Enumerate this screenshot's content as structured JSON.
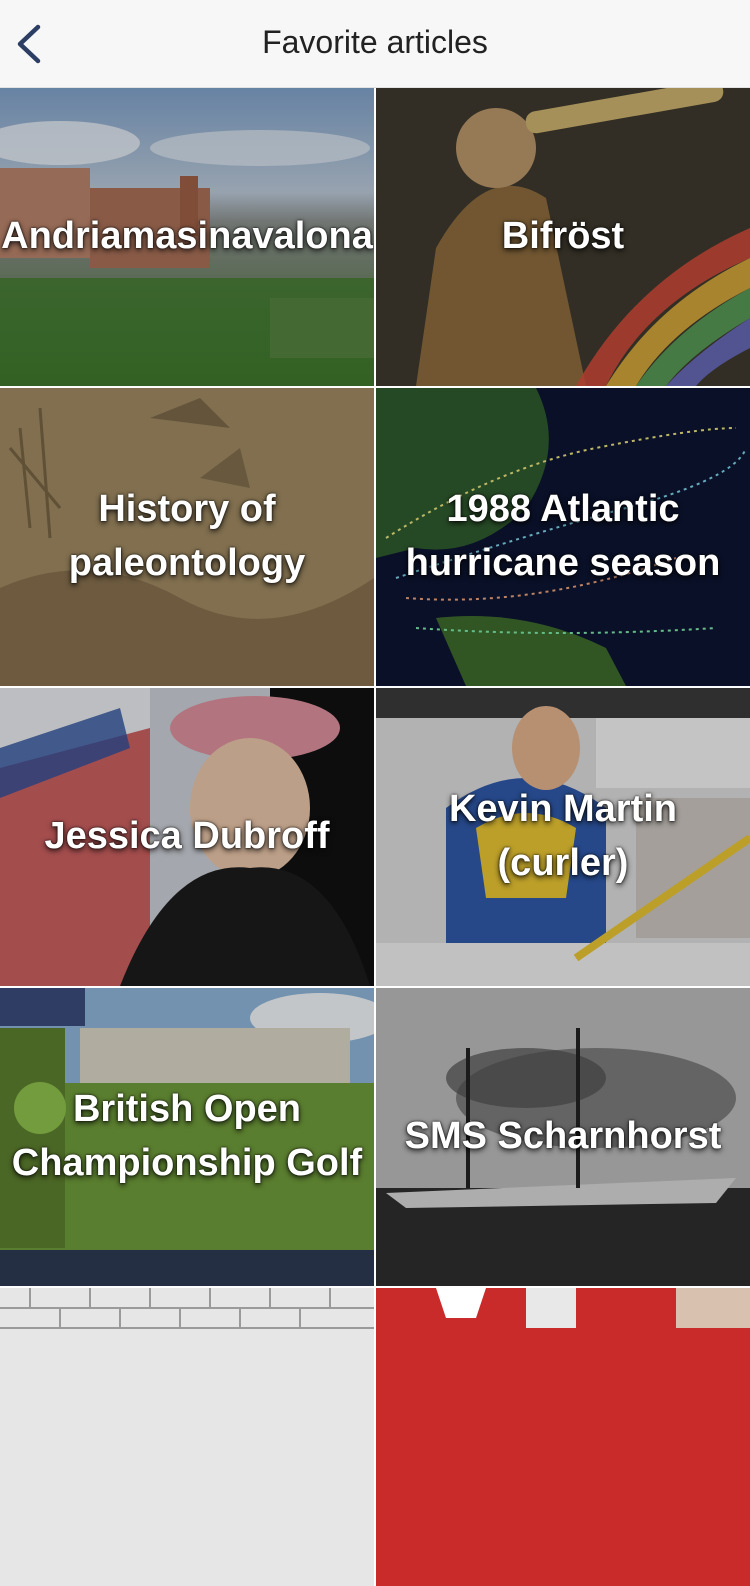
{
  "header": {
    "title": "Favorite articles",
    "back_icon": "chevron-left-icon"
  },
  "articles": [
    {
      "title": "Andriamasinavalona"
    },
    {
      "title": "Bifröst"
    },
    {
      "title": "History of paleontology"
    },
    {
      "title": "1988 Atlantic hurricane season"
    },
    {
      "title": "Jessica Dubroff"
    },
    {
      "title": "Kevin Martin (curler)"
    },
    {
      "title": "British Open Championship Golf"
    },
    {
      "title": "SMS Scharnhorst"
    },
    {
      "title": ""
    },
    {
      "title": ""
    }
  ],
  "colors": {
    "header_bg": "#f7f7f7",
    "accent": "#2c3e63"
  }
}
